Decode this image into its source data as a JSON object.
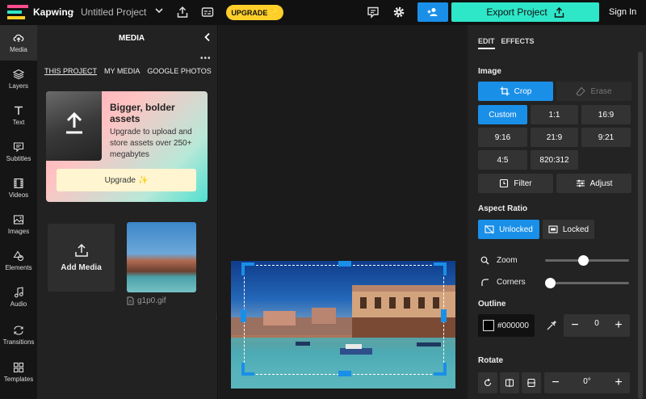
{
  "header": {
    "brand": "Kapwing",
    "project_title": "Untitled Project",
    "upgrade_label": "UPGRADE",
    "export_label": "Export Project",
    "sign_in": "Sign In"
  },
  "rail": {
    "items": [
      {
        "label": "Media"
      },
      {
        "label": "Layers"
      },
      {
        "label": "Text"
      },
      {
        "label": "Subtitles"
      },
      {
        "label": "Videos"
      },
      {
        "label": "Images"
      },
      {
        "label": "Elements"
      },
      {
        "label": "Audio"
      },
      {
        "label": "Transitions"
      },
      {
        "label": "Templates"
      }
    ]
  },
  "media_panel": {
    "title": "MEDIA",
    "more": "•••",
    "tabs": [
      "THIS PROJECT",
      "MY MEDIA",
      "GOOGLE PHOTOS"
    ],
    "promo": {
      "heading": "Bigger, bolder assets",
      "body": "Upgrade to upload and store assets over 250+ megabytes",
      "button": "Upgrade"
    },
    "add_media": "Add Media",
    "asset_name": "g1p0.gif"
  },
  "right_panel": {
    "tabs": [
      "EDIT",
      "EFFECTS"
    ],
    "image_label": "Image",
    "crop": "Crop",
    "erase": "Erase",
    "ratios": [
      "Custom",
      "1:1",
      "16:9",
      "9:16",
      "21:9",
      "9:21",
      "4:5",
      "820:312"
    ],
    "filter": "Filter",
    "adjust": "Adjust",
    "aspect_label": "Aspect Ratio",
    "unlocked": "Unlocked",
    "locked": "Locked",
    "zoom": "Zoom",
    "corners": "Corners",
    "zoom_level": 0.45,
    "corners_level": 0.0,
    "outline_label": "Outline",
    "outline_color": "#000000",
    "outline_width": "0",
    "rotate_label": "Rotate",
    "rotate_value": "0°"
  },
  "colors": {
    "accent": "#1a8fe8",
    "export": "#2ee6c8",
    "upgrade": "#ffcf2a"
  }
}
